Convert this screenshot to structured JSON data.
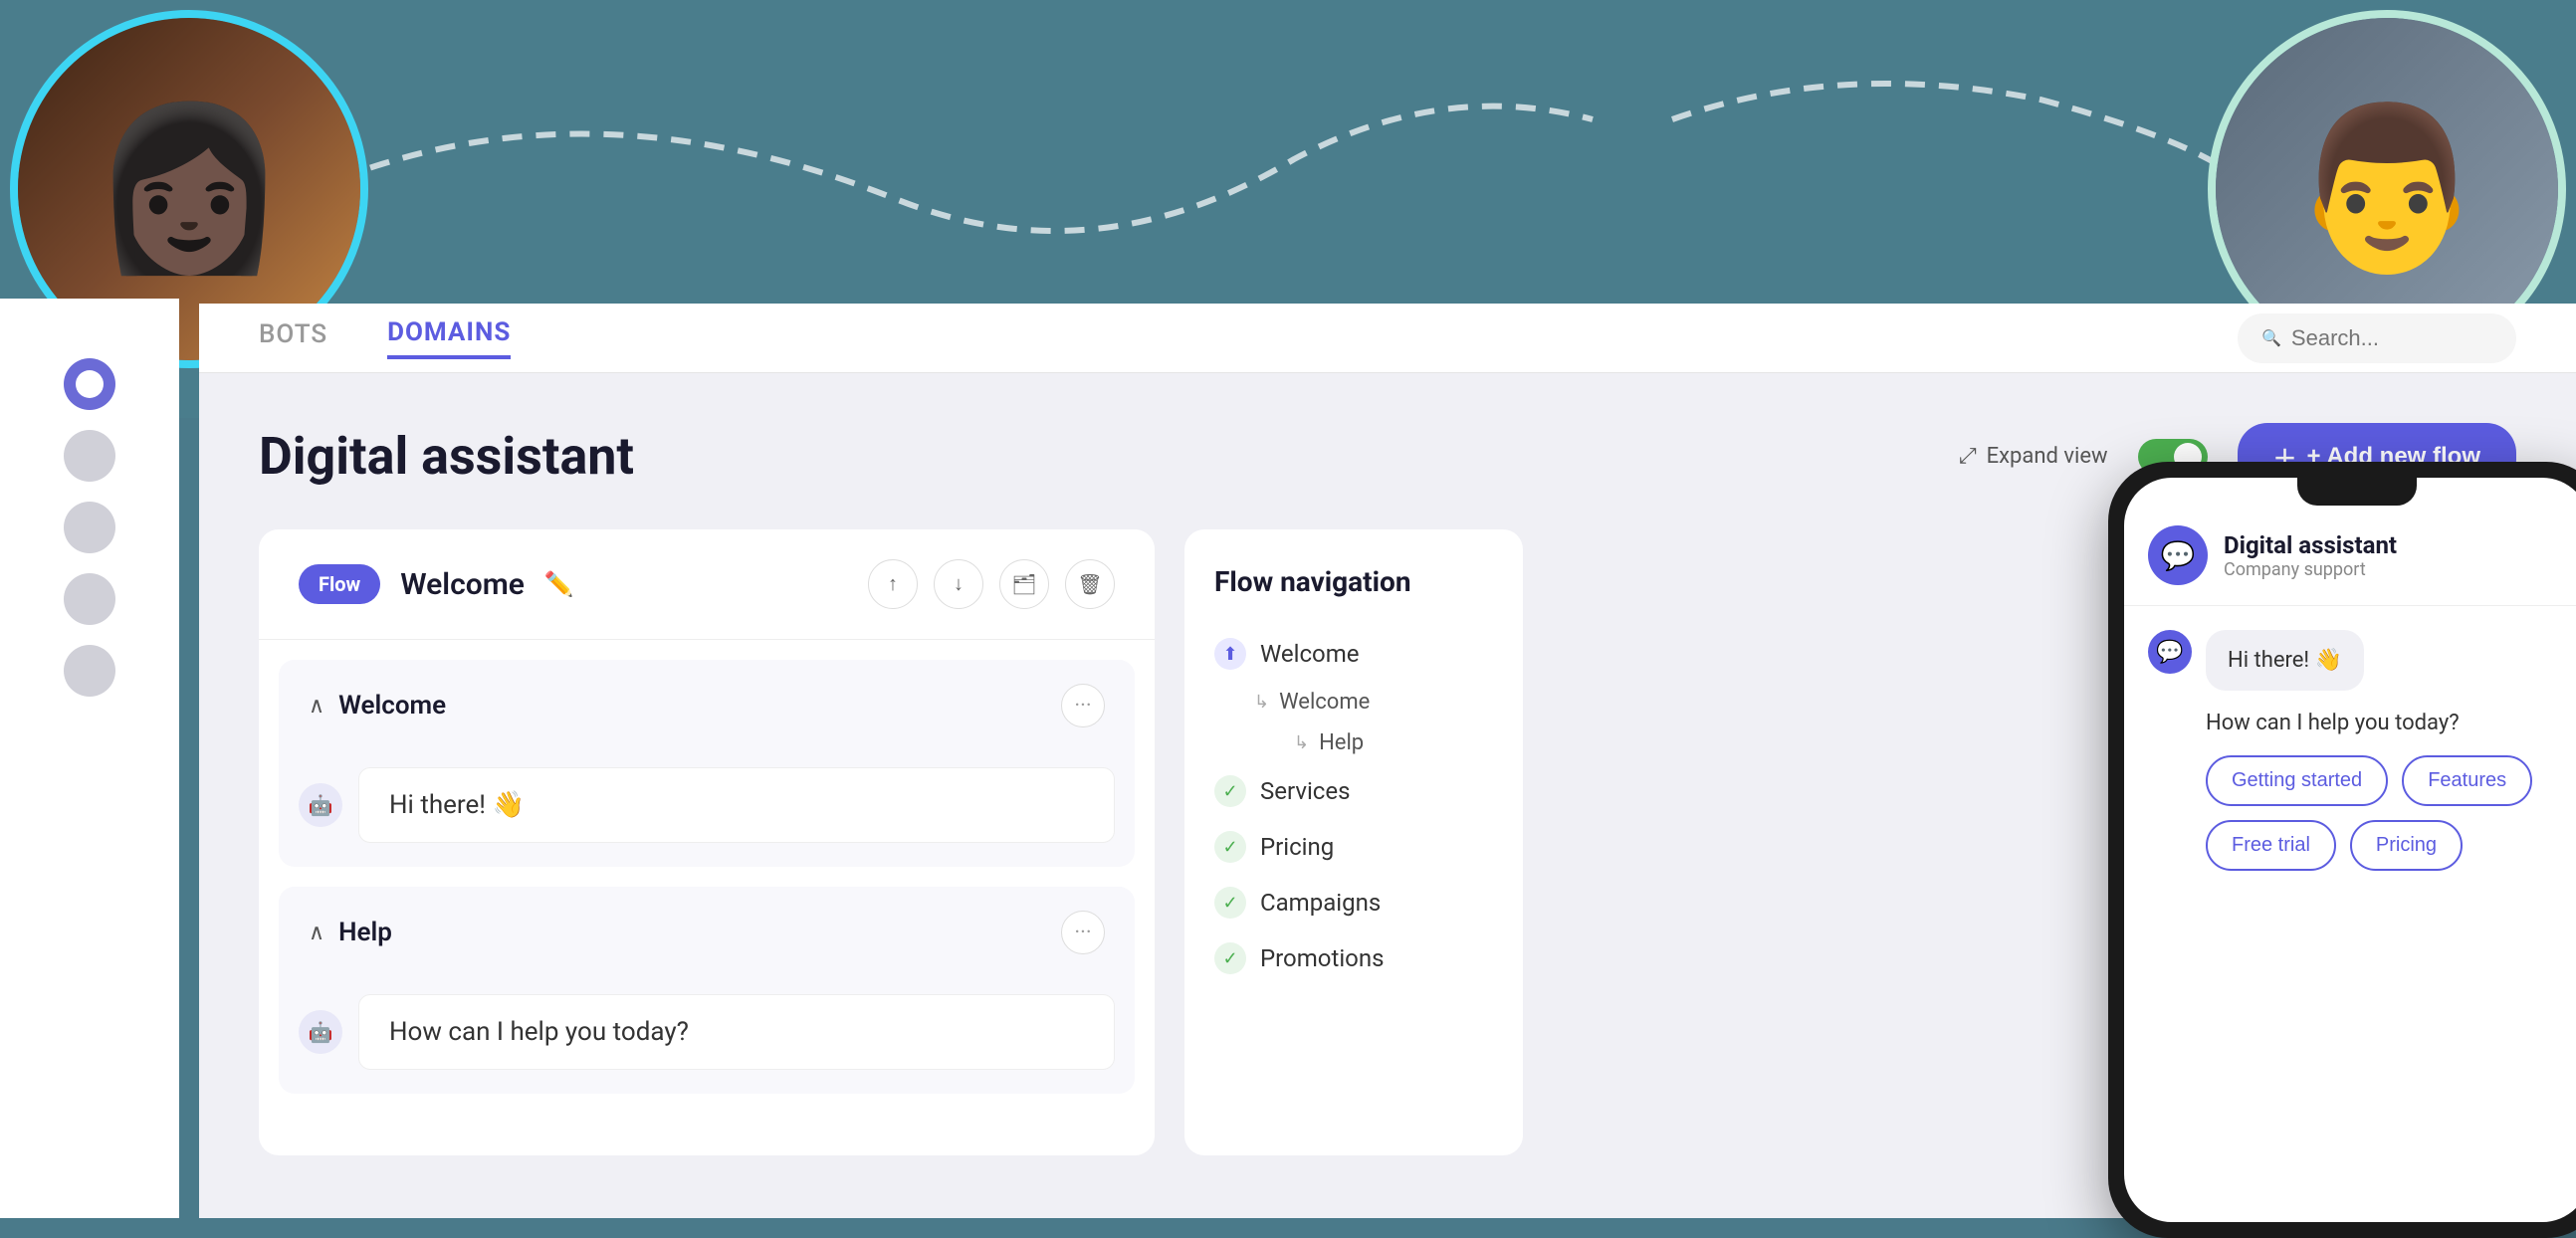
{
  "background": {
    "teal_color": "#4a7d8c"
  },
  "nav": {
    "tabs": [
      {
        "id": "bots",
        "label": "BOTS",
        "active": false
      },
      {
        "id": "domains",
        "label": "DOMAINS",
        "active": true
      }
    ],
    "search_placeholder": "Search..."
  },
  "sidebar": {
    "items": [
      {
        "id": "active",
        "active": true
      },
      {
        "id": "s2",
        "active": false
      },
      {
        "id": "s3",
        "active": false
      },
      {
        "id": "s4",
        "active": false
      },
      {
        "id": "s5",
        "active": false
      }
    ]
  },
  "page": {
    "title": "Digital assistant",
    "expand_view_label": "Expand view",
    "add_flow_label": "+ Add new flow",
    "flow_badge": "Flow",
    "flow_name": "Welcome",
    "sections": [
      {
        "title": "Welcome",
        "message": "Hi there! 👋"
      },
      {
        "title": "Help",
        "message": "How can I help you today?"
      }
    ]
  },
  "flow_nav": {
    "title": "Flow navigation",
    "items": [
      {
        "label": "Welcome",
        "type": "blue",
        "children": [
          {
            "label": "Welcome"
          },
          {
            "label": "Help"
          }
        ]
      },
      {
        "label": "Services",
        "type": "green"
      },
      {
        "label": "Pricing",
        "type": "green"
      },
      {
        "label": "Campaigns",
        "type": "green"
      },
      {
        "label": "Promotions",
        "type": "green"
      }
    ]
  },
  "phone": {
    "assistant_name": "Digital assistant",
    "assistant_sub": "Company support",
    "greeting": "Hi there! 👋",
    "question": "How can I help you today?",
    "options": [
      {
        "label": "Getting started"
      },
      {
        "label": "Features"
      },
      {
        "label": "Free trial"
      },
      {
        "label": "Pricing"
      }
    ]
  },
  "icons": {
    "search": "🔍",
    "edit": "✏️",
    "up_arrow": "↑",
    "down_arrow": "↓",
    "folder": "🗂",
    "trash": "🗑",
    "dots": "•••",
    "expand": "⤢",
    "plus": "+",
    "chat_bubble": "💬",
    "bot": "🤖",
    "chevron_down": "∧",
    "arrow_sub": "↳"
  }
}
